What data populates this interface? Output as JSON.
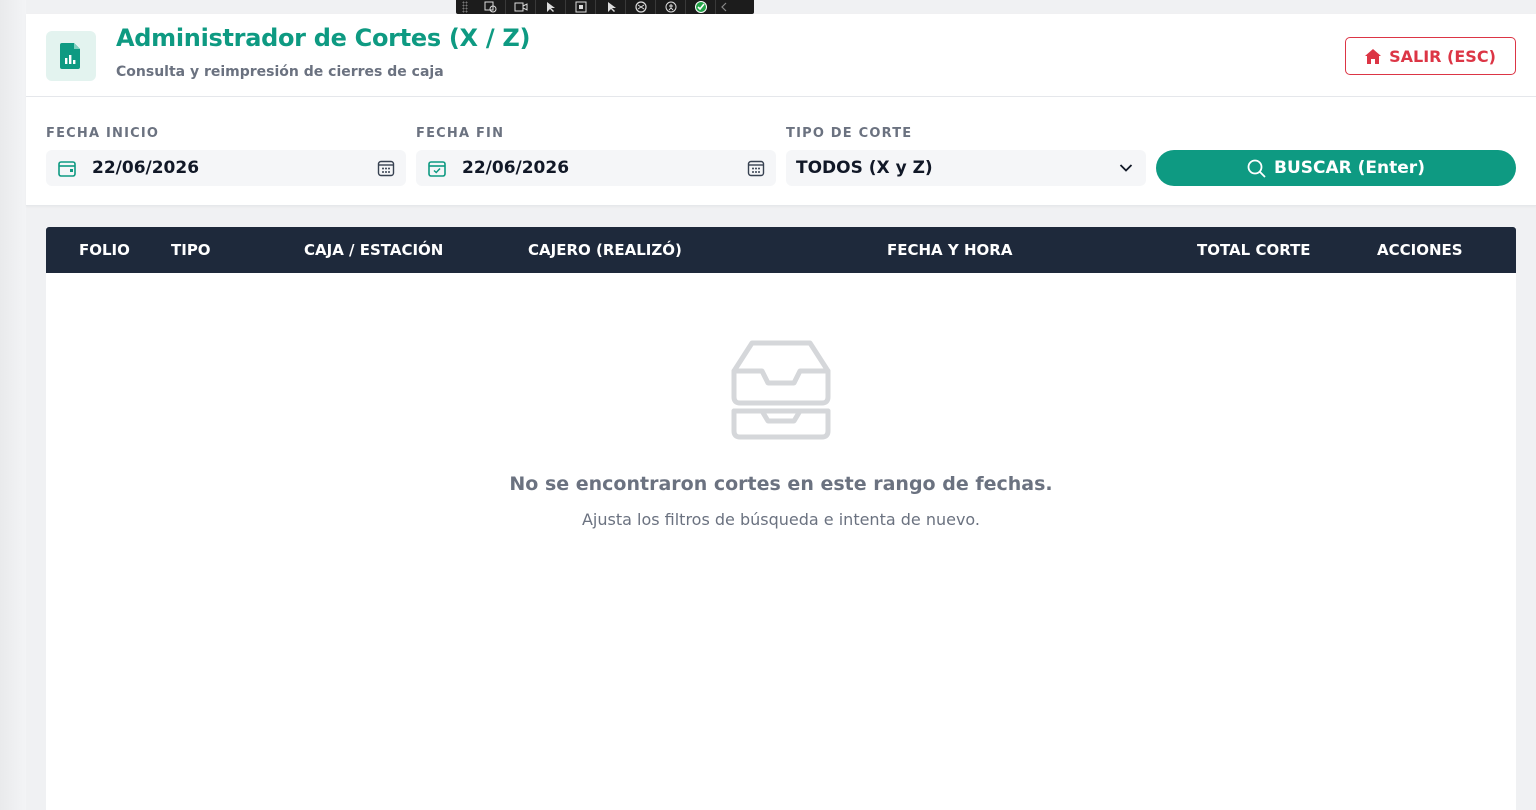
{
  "app": {
    "title": "Administrador de Cortes (X / Z)",
    "subtitle": "Consulta y reimpresión de cierres de caja",
    "exit_label": "SALIR (ESC)",
    "accent_color": "#0e9a82",
    "danger_color": "#dc3545",
    "header_icon": "file-chart-icon"
  },
  "filters": {
    "start_date": {
      "label": "FECHA INICIO",
      "value": "22/06/2026"
    },
    "end_date": {
      "label": "FECHA FIN",
      "value": "22/06/2026"
    },
    "cut_type": {
      "label": "TIPO DE CORTE",
      "value": "TODOS (X y Z)"
    },
    "search_label": "BUSCAR (Enter)"
  },
  "table": {
    "columns": [
      "FOLIO",
      "TIPO",
      "CAJA / ESTACIÓN",
      "CAJERO (REALIZÓ)",
      "FECHA Y HORA",
      "TOTAL CORTE",
      "ACCIONES"
    ],
    "header_color": "#1e293b",
    "rows": []
  },
  "empty_state": {
    "icon": "inbox-tray-icon",
    "title": "No se encontraron cortes en este rango de fechas.",
    "subtitle": "Ajusta los filtros de búsqueda e intenta de nuevo."
  }
}
